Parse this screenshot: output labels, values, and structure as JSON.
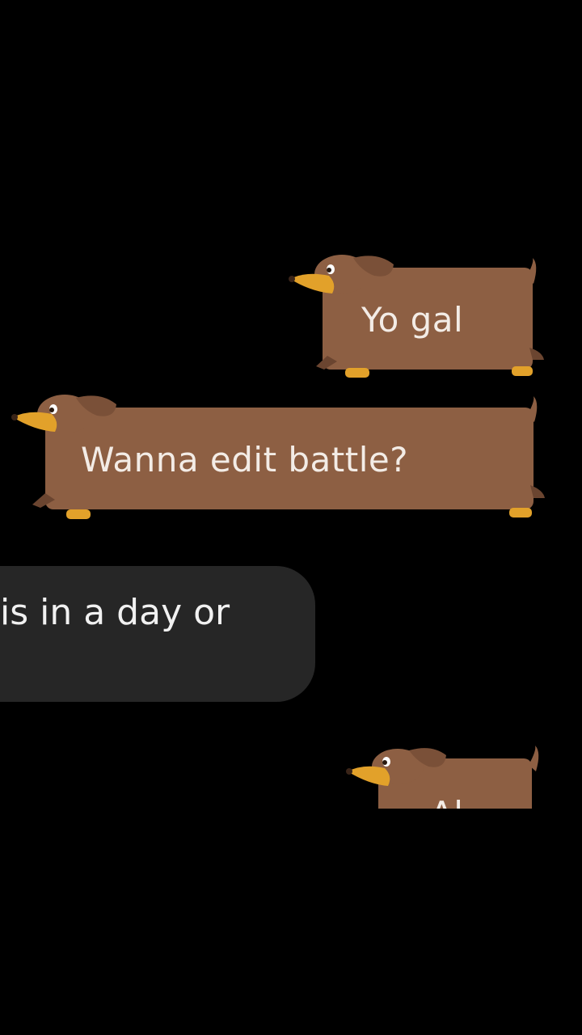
{
  "messages": [
    {
      "type": "sent-dog",
      "text": "Yo gal"
    },
    {
      "type": "sent-dog",
      "text": "Wanna edit battle?"
    },
    {
      "type": "received",
      "text": "is in a day or"
    },
    {
      "type": "sent-dog",
      "text": "Al"
    }
  ],
  "colors": {
    "background": "#000000",
    "dog_body": "#8d5f43",
    "dog_dark": "#6b4530",
    "snout": "#e2a12a",
    "received_bubble": "#262626"
  }
}
